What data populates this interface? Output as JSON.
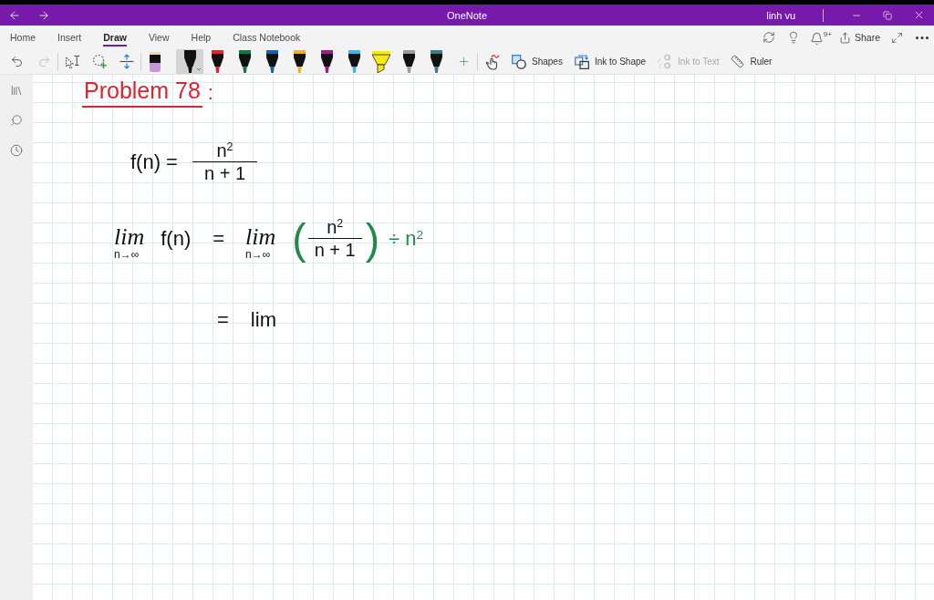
{
  "title_bar": {
    "title": "OneNote",
    "user": "linh vu"
  },
  "ribbon": {
    "tabs": [
      {
        "label": "Home",
        "selected": false
      },
      {
        "label": "Insert",
        "selected": false
      },
      {
        "label": "Draw",
        "selected": true
      },
      {
        "label": "View",
        "selected": false
      },
      {
        "label": "Help",
        "selected": false
      },
      {
        "label": "Class Notebook",
        "selected": false
      }
    ],
    "notifications": {
      "count": "9+"
    },
    "share": {
      "label": "Share"
    }
  },
  "draw_toolbar": {
    "undo": {
      "disabled": false
    },
    "redo": {
      "disabled": true
    },
    "pens": [
      {
        "kind": "eraser",
        "color": "#c996d9",
        "selected": false
      },
      {
        "kind": "pen",
        "color": "#111111",
        "selected": true
      },
      {
        "kind": "pen",
        "color": "#e0262b",
        "selected": false
      },
      {
        "kind": "pen",
        "color": "#0e7a45",
        "selected": false
      },
      {
        "kind": "pen",
        "color": "#1565a8",
        "selected": false
      },
      {
        "kind": "pen",
        "color": "#f0b21c",
        "selected": false
      },
      {
        "kind": "pen",
        "color": "#9c1c8c",
        "selected": false
      },
      {
        "kind": "pen",
        "color": "#3cb7e8",
        "selected": false
      },
      {
        "kind": "highlighter",
        "color": "#f6ea16",
        "selected": false
      },
      {
        "kind": "pen",
        "color": "#9a9a9a",
        "selected": false
      },
      {
        "kind": "pen",
        "color": "#3f7a8a",
        "selected": false
      }
    ],
    "tools": [
      {
        "label": "Shapes",
        "disabled": false
      },
      {
        "label": "Ink to Shape",
        "disabled": false
      },
      {
        "label": "Ink to Text",
        "disabled": true
      },
      {
        "label": "Ruler",
        "disabled": false
      }
    ]
  },
  "page": {
    "ink": [
      {
        "parts": [
          {
            "kind": "underlined",
            "text": "Problem 78",
            "color": "#d8262f"
          },
          {
            "kind": "text",
            "text": ":",
            "color": "#d8262f"
          }
        ]
      },
      {
        "parts": [
          {
            "kind": "text",
            "text": "f(n) =",
            "color": "#111111"
          },
          {
            "kind": "fraction",
            "numerator": "n$^{2}$",
            "denominator": "n + 1",
            "color": "#111111"
          }
        ]
      },
      {
        "parts": [
          {
            "kind": "limit",
            "text": "lim",
            "under": "n→∞",
            "color": "#111111"
          },
          {
            "kind": "text",
            "text": "f(n)",
            "color": "#111111"
          },
          {
            "kind": "text",
            "text": "=",
            "color": "#111111"
          },
          {
            "kind": "limit",
            "text": "lim",
            "under": "n→∞",
            "color": "#111111"
          },
          {
            "kind": "paren",
            "text": "(",
            "color": "#1f8a4c"
          },
          {
            "kind": "fraction",
            "numerator": "n$^{2}$",
            "denominator": "n + 1",
            "color": "#111111"
          },
          {
            "kind": "paren",
            "text": ")",
            "color": "#1f8a4c"
          },
          {
            "kind": "text",
            "text": "÷ n$^{2}$",
            "color": "#1f8a4c"
          }
        ]
      },
      {
        "parts": [
          {
            "kind": "text",
            "text": "=",
            "color": "#111111"
          },
          {
            "kind": "text",
            "text": "lim",
            "color": "#111111"
          }
        ]
      }
    ]
  }
}
